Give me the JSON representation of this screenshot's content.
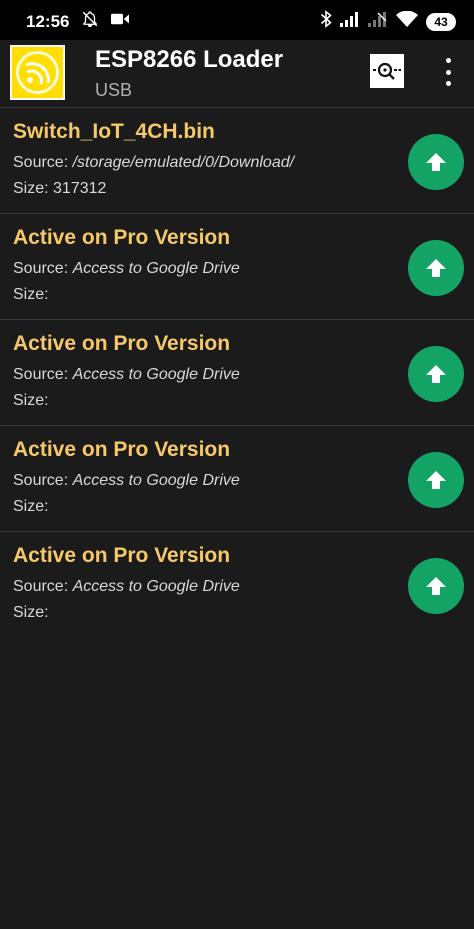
{
  "status_bar": {
    "time": "12:56",
    "battery": "43"
  },
  "app_bar": {
    "title": "ESP8266 Loader",
    "subtitle": "USB"
  },
  "labels": {
    "source": "Source: ",
    "size": "Size: "
  },
  "files": [
    {
      "name": "Switch_IoT_4CH.bin",
      "source": "/storage/emulated/0/Download/",
      "size": "317312"
    },
    {
      "name": "Active on Pro Version",
      "source": "Access to Google Drive",
      "size": ""
    },
    {
      "name": "Active on Pro Version",
      "source": "Access to Google Drive",
      "size": ""
    },
    {
      "name": "Active on Pro Version",
      "source": "Access to Google Drive",
      "size": ""
    },
    {
      "name": "Active on Pro Version",
      "source": "Access to Google Drive",
      "size": ""
    }
  ],
  "colors": {
    "accent_green": "#13a365",
    "file_name": "#f7c86a",
    "logo_yellow": "#ffde00",
    "background": "#1a1b1a"
  },
  "icons": {
    "dnd": "dnd-icon",
    "video": "video-icon",
    "bluetooth": "bluetooth-icon",
    "signal": "signal-icon",
    "wifi": "wifi-icon",
    "battery": "battery-icon",
    "scan": "scan-icon",
    "more": "more-vert-icon",
    "upload": "arrow-up-icon"
  }
}
